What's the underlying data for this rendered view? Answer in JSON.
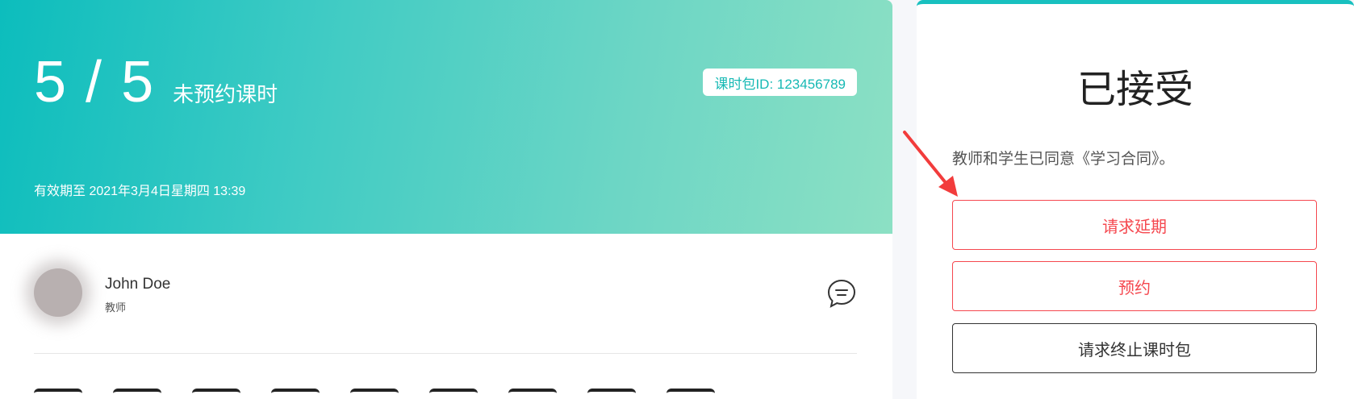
{
  "package": {
    "remaining": "5",
    "total": "5",
    "count_separator": " / ",
    "count_label": "未预约课时",
    "id_badge": "课时包ID: 123456789",
    "expiry": "有效期至 2021年3月4日星期四 13:39"
  },
  "teacher": {
    "name": "John Doe",
    "role": "教师"
  },
  "status": {
    "title": "已接受",
    "description": "教师和学生已同意《学习合同》。"
  },
  "actions": {
    "extend_label": "请求延期",
    "book_label": "预约",
    "terminate_label": "请求终止课时包"
  },
  "colors": {
    "accent": "#16b9b4",
    "danger": "#f5484f",
    "arrow": "#f23c3c"
  },
  "icons": {
    "chat": "chat-bubble-icon",
    "arrow": "red-arrow-annotation"
  }
}
